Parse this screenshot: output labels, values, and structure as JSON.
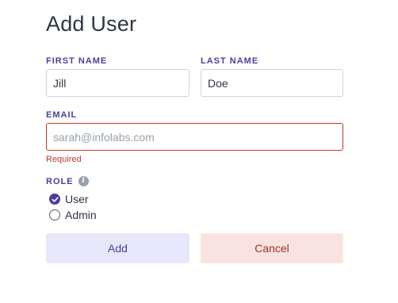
{
  "form": {
    "title": "Add User",
    "first_name": {
      "label": "FIRST NAME",
      "value": "Jill"
    },
    "last_name": {
      "label": "LAST NAME",
      "value": "Doe"
    },
    "email": {
      "label": "EMAIL",
      "value": "",
      "placeholder": "sarah@infolabs.com",
      "error": "Required"
    },
    "role": {
      "label": "ROLE",
      "info_icon": "info-icon",
      "options": [
        {
          "label": "User",
          "selected": true
        },
        {
          "label": "Admin",
          "selected": false
        }
      ]
    },
    "buttons": {
      "add_label": "Add",
      "cancel_label": "Cancel"
    }
  },
  "colors": {
    "accent": "#4a3f9e",
    "error": "#c0392b",
    "add_button_bg": "#e8e6fa",
    "cancel_button_bg": "#f9e3e1",
    "cancel_text": "#a3301f"
  }
}
